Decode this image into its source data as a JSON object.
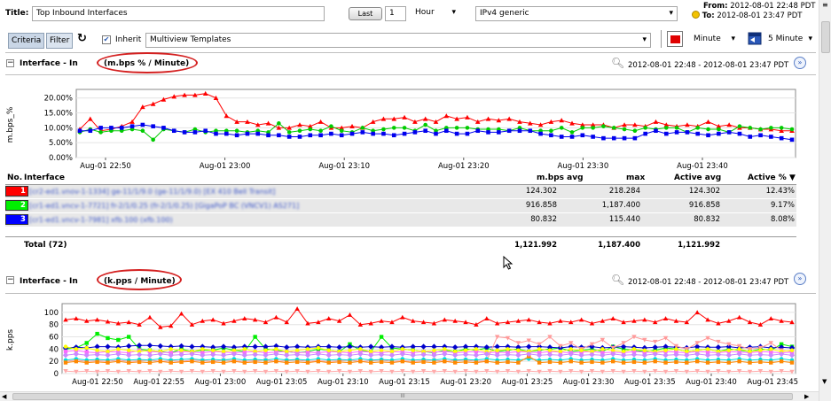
{
  "header": {
    "title_label": "Title:",
    "title_value": "Top Inbound Interfaces",
    "last_button": "Last",
    "last_value": "1",
    "unit_select": "Hour",
    "template_select": "IPv4 generic",
    "from_label": "From:",
    "from_value": "2012-08-01 22:48 PDT",
    "to_label": "To:",
    "to_value": "2012-08-01 23:47 PDT"
  },
  "toolbar": {
    "tab_criteria": "Criteria",
    "tab_filter": "Filter",
    "inherit_label": "Inherit",
    "multiview_value": "Multiview Templates",
    "interval_select": "Minute",
    "refresh_select": "5 Minute"
  },
  "section1": {
    "title_prefix": "Interface - In",
    "title_unit": "(m.bps % / Minute)",
    "range": "2012-08-01 22:48  - 2012-08-01 23:47 PDT",
    "chart_data": {
      "type": "line",
      "ylabel": "m.bps_%",
      "ylim": [
        0,
        22
      ],
      "yticks": [
        "20.00%",
        "15.00%",
        "10.00%",
        "5.00%",
        "0.00%"
      ],
      "yvals": [
        20,
        15,
        10,
        5,
        0
      ],
      "xticks": [
        "Aug-01 22:50",
        "Aug-01 23:00",
        "Aug-01 23:10",
        "Aug-01 23:20",
        "Aug-01 23:30",
        "Aug-01 23:40"
      ],
      "series": [
        {
          "color": "#ff0000",
          "marker": "triangle",
          "values": [
            9.5,
            13,
            9,
            9.5,
            10.5,
            12,
            17,
            18,
            19.5,
            20.5,
            21,
            21,
            21.5,
            20,
            14,
            12,
            12,
            11,
            11.5,
            10,
            10,
            11,
            10.5,
            12,
            10,
            10,
            10.5,
            10,
            12,
            13,
            13,
            13.5,
            12,
            13,
            12,
            14,
            13,
            13.5,
            12,
            13,
            12.5,
            13,
            12,
            11.5,
            11,
            12,
            12.5,
            11.5,
            11,
            11,
            11,
            10,
            11,
            11,
            10.5,
            12,
            11,
            10.5,
            11,
            10.5,
            12,
            10.5,
            11,
            10,
            10,
            9.5,
            9.5,
            9,
            9
          ]
        },
        {
          "color": "#00cc00",
          "marker": "circle",
          "values": [
            8.5,
            9.5,
            8.5,
            9,
            9,
            9.5,
            9,
            6,
            9.5,
            9,
            8.5,
            9.5,
            8.5,
            9,
            9,
            9,
            8.5,
            9,
            8.5,
            11.5,
            8.5,
            9,
            9.5,
            9,
            10.5,
            9,
            8.5,
            10,
            9,
            9.5,
            10,
            10,
            9,
            11,
            9,
            10,
            10,
            10,
            9.5,
            9.5,
            9.5,
            9,
            10,
            9,
            9,
            9,
            10,
            8.5,
            10,
            10,
            10.5,
            10,
            9.5,
            9,
            10,
            9.5,
            10,
            10,
            8.5,
            10,
            9.5,
            9.5,
            8.5,
            10.5,
            10,
            9.5,
            10,
            10,
            9.5
          ]
        },
        {
          "color": "#0000ee",
          "marker": "square",
          "values": [
            9,
            9,
            10,
            10,
            10,
            10.5,
            11,
            10.5,
            10,
            9,
            8.5,
            8.5,
            9,
            8,
            8,
            7.5,
            8,
            8,
            7.5,
            7.5,
            7,
            7,
            7.5,
            7.5,
            8,
            7.5,
            8,
            8.5,
            8,
            8,
            7.5,
            8,
            8.5,
            9,
            8,
            9,
            8,
            8,
            9,
            8.5,
            8.5,
            9,
            9,
            9,
            8,
            7.5,
            7,
            7,
            7.5,
            7,
            6.5,
            6.5,
            6.5,
            6.5,
            8,
            9,
            8,
            8.5,
            8.5,
            8,
            7.5,
            8,
            8.5,
            8,
            7,
            7.5,
            7,
            6.5,
            6
          ]
        }
      ]
    },
    "table": {
      "headers": [
        "No.",
        "Interface",
        "m.bps avg",
        "max",
        "Active avg",
        "Active %"
      ],
      "rows": [
        {
          "no": "1",
          "color": "#ff0000",
          "name": "[cr2-ed1.vnov-1-1334] ge-11/1/9.0 (ge-11/1/9.0) [EX 410 Bell Transit]",
          "avg": "124.302",
          "max": "218.284",
          "active_avg": "124.302",
          "active_pct": "12.43%"
        },
        {
          "no": "2",
          "color": "#00ee00",
          "name": "[cr1-ed1.vncv-1-7721] fr-2/1/0.25 (fr-2/1/0.25) [GigaPoP BC (VNCV1) AS271]",
          "avg": "916.858",
          "max": "1,187.400",
          "active_avg": "916.858",
          "active_pct": "9.17%"
        },
        {
          "no": "3",
          "color": "#0000ff",
          "name": "[cr1-ed1.vncv-1-7981] xfb.100 (xfb.100)",
          "avg": "80.832",
          "max": "115.440",
          "active_avg": "80.832",
          "active_pct": "8.08%"
        }
      ],
      "total_label": "Total (72)",
      "total": {
        "avg": "1,121.992",
        "max": "1,187.400",
        "active_avg": "1,121.992"
      }
    }
  },
  "section2": {
    "title_prefix": "Interface - In",
    "title_unit": "(k.pps / Minute)",
    "range": "2012-08-01 22:48  - 2012-08-01 23:47 PDT",
    "chart_data": {
      "type": "line",
      "ylabel": "k.pps",
      "ylim": [
        0,
        110
      ],
      "yticks": [
        "100",
        "80",
        "60",
        "40",
        "20",
        "0"
      ],
      "yvals": [
        100,
        80,
        60,
        40,
        20,
        0
      ],
      "xticks": [
        "Aug-01 22:50",
        "Aug-01 22:55",
        "Aug-01 23:00",
        "Aug-01 23:05",
        "Aug-01 23:10",
        "Aug-01 23:15",
        "Aug-01 23:20",
        "Aug-01 23:25",
        "Aug-01 23:30",
        "Aug-01 23:35",
        "Aug-01 23:40",
        "Aug-01 23:45"
      ],
      "series": [
        {
          "color": "#ff0000",
          "marker": "triangle",
          "values": [
            88,
            90,
            86,
            88,
            85,
            82,
            84,
            80,
            92,
            76,
            78,
            98,
            80,
            86,
            88,
            82,
            86,
            90,
            88,
            84,
            92,
            84,
            106,
            82,
            84,
            90,
            86,
            96,
            80,
            82,
            86,
            84,
            92,
            86,
            84,
            82,
            88,
            86,
            84,
            80,
            90,
            82,
            84,
            86,
            88,
            84,
            82,
            86,
            84,
            88,
            82,
            86,
            90,
            84,
            86,
            88,
            84,
            90,
            86,
            84,
            100,
            88,
            82,
            86,
            92,
            84,
            80,
            90,
            86,
            84
          ]
        },
        {
          "color": "#00ee00",
          "marker": "square",
          "values": [
            40,
            42,
            50,
            65,
            58,
            55,
            60,
            40,
            38,
            36,
            34,
            40,
            36,
            38,
            38,
            42,
            38,
            36,
            60,
            40,
            38,
            36,
            34,
            36,
            40,
            38,
            36,
            48,
            38,
            36,
            60,
            42,
            40,
            38,
            36,
            34,
            38,
            36,
            40,
            38,
            42,
            36,
            38,
            40,
            36,
            38,
            40,
            42,
            36,
            38,
            40,
            36,
            44,
            40,
            38,
            36,
            38,
            42,
            40,
            36,
            38,
            40,
            36,
            40,
            38,
            36,
            40,
            38,
            48,
            44
          ]
        },
        {
          "color": "#0000cc",
          "marker": "diamond",
          "values": [
            42,
            43,
            42,
            44,
            44,
            43,
            45,
            46,
            46,
            45,
            44,
            45,
            44,
            44,
            43,
            44,
            43,
            44,
            44,
            44,
            45,
            43,
            44,
            43,
            44,
            44,
            43,
            44,
            43,
            44,
            43,
            44,
            43,
            44,
            44,
            44,
            44,
            43,
            44,
            44,
            43,
            44,
            44,
            43,
            44,
            44,
            43,
            42,
            44,
            43,
            44,
            42,
            43,
            44,
            43,
            42,
            43,
            44,
            43,
            42,
            44,
            43,
            43,
            44,
            42,
            43,
            44,
            42,
            43,
            42
          ]
        },
        {
          "color": "#ff9999",
          "marker": "triangle-down",
          "values": [
            20,
            22,
            20,
            21,
            20,
            22,
            20,
            21,
            22,
            20,
            21,
            20,
            22,
            21,
            20,
            22,
            21,
            20,
            21,
            22,
            20,
            21,
            22,
            20,
            21,
            20,
            21,
            22,
            20,
            21,
            22,
            20,
            21,
            20,
            21,
            22,
            20,
            21,
            22,
            20,
            21,
            60,
            58,
            50,
            54,
            48,
            60,
            45,
            50,
            40,
            48,
            55,
            42,
            50,
            60,
            55,
            52,
            58,
            45,
            40,
            50,
            58,
            52,
            48,
            45,
            40,
            42,
            50,
            38,
            36
          ]
        },
        {
          "color": "#ff66ff",
          "marker": "square",
          "values": [
            36,
            38,
            35,
            34,
            36,
            35,
            34,
            38,
            36,
            35,
            34,
            36,
            35,
            34,
            36,
            35,
            34,
            35,
            36,
            34,
            35,
            36,
            34,
            35,
            34,
            36,
            35,
            34,
            36,
            35,
            34,
            36,
            35,
            34,
            36,
            35,
            36,
            34,
            35,
            36,
            34,
            35,
            34,
            36,
            35,
            34,
            36,
            35,
            34,
            35,
            36,
            34,
            35,
            34,
            36,
            35,
            34,
            36,
            35,
            34,
            36,
            35,
            34,
            36,
            35,
            34,
            36,
            35,
            34,
            35
          ]
        },
        {
          "color": "#ffff00",
          "marker": "circle",
          "values": [
            44,
            40,
            42,
            38,
            36,
            40,
            38,
            36,
            38,
            36,
            40,
            38,
            36,
            40,
            38,
            36,
            38,
            40,
            36,
            38,
            40,
            36,
            38,
            40,
            42,
            38,
            36,
            38,
            40,
            36,
            38,
            36,
            40,
            38,
            36,
            38,
            40,
            36,
            38,
            40,
            36,
            38,
            40,
            38,
            36,
            40,
            38,
            36,
            40,
            38,
            36,
            40,
            38,
            36,
            40,
            38,
            36,
            38,
            40,
            36,
            38,
            40,
            36,
            38,
            40,
            36,
            38,
            40,
            36,
            38
          ]
        },
        {
          "color": "#00dddd",
          "marker": "circle",
          "values": [
            22,
            24,
            22,
            23,
            22,
            24,
            22,
            23,
            22,
            24,
            22,
            23,
            24,
            22,
            23,
            22,
            24,
            22,
            23,
            22,
            24,
            22,
            23,
            22,
            24,
            22,
            23,
            22,
            24,
            22,
            23,
            22,
            24,
            22,
            23,
            22,
            24,
            22,
            23,
            22,
            24,
            22,
            23,
            22,
            24,
            22,
            23,
            22,
            24,
            22,
            23,
            22,
            24,
            22,
            23,
            22,
            24,
            22,
            23,
            22,
            24,
            22,
            23,
            22,
            24,
            22,
            23,
            22,
            24,
            22
          ]
        },
        {
          "color": "#ff8800",
          "marker": "square",
          "values": [
            18,
            20,
            18,
            19,
            18,
            20,
            18,
            19,
            18,
            20,
            18,
            19,
            20,
            18,
            19,
            18,
            20,
            18,
            19,
            18,
            20,
            18,
            19,
            18,
            20,
            18,
            19,
            18,
            20,
            18,
            19,
            18,
            20,
            18,
            19,
            18,
            20,
            18,
            19,
            18,
            20,
            18,
            19,
            18,
            28,
            18,
            19,
            18,
            20,
            18,
            19,
            18,
            20,
            18,
            19,
            18,
            20,
            18,
            19,
            18,
            20,
            18,
            19,
            18,
            20,
            18,
            19,
            18,
            20,
            18
          ]
        },
        {
          "color": "#cc88ff",
          "marker": "diamond",
          "values": [
            30,
            32,
            30,
            31,
            30,
            32,
            30,
            31,
            30,
            32,
            30,
            31,
            32,
            30,
            31,
            30,
            32,
            30,
            31,
            30,
            32,
            30,
            31,
            30,
            32,
            30,
            31,
            30,
            32,
            30,
            31,
            30,
            32,
            30,
            31,
            30,
            32,
            30,
            31,
            30,
            32,
            30,
            31,
            30,
            32,
            30,
            31,
            30,
            32,
            30,
            31,
            30,
            32,
            30,
            31,
            30,
            32,
            30,
            31,
            30,
            32,
            30,
            31,
            30,
            32,
            30,
            31,
            30,
            32,
            30
          ]
        },
        {
          "color": "#ffaaaa",
          "marker": "triangle-down",
          "values": [
            4,
            3,
            4,
            3,
            4,
            3,
            4,
            3,
            4,
            3,
            4,
            3,
            4,
            3,
            4,
            3,
            4,
            3,
            4,
            3,
            4,
            3,
            4,
            3,
            4,
            3,
            4,
            3,
            4,
            3,
            4,
            3,
            4,
            3,
            4,
            3,
            4,
            3,
            4,
            3,
            4,
            3,
            4,
            3,
            4,
            3,
            4,
            3,
            4,
            3,
            4,
            3,
            4,
            3,
            4,
            3,
            4,
            3,
            4,
            3,
            4,
            3,
            4,
            3,
            4,
            3,
            4,
            3,
            4,
            3
          ]
        }
      ]
    }
  },
  "scrollbar": {
    "h_grip": "III"
  }
}
